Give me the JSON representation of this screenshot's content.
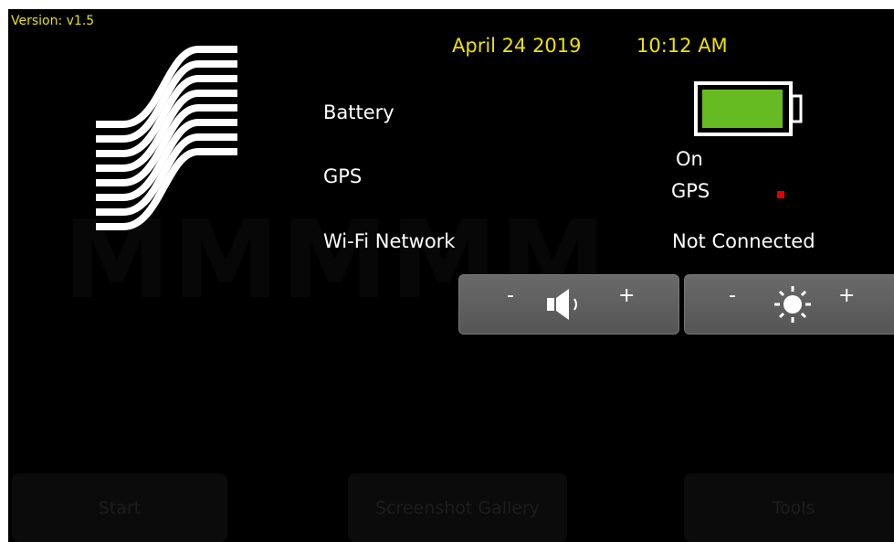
{
  "header": {
    "version": "Version: v1.5",
    "date": "April 24 2019",
    "time": "10:12 AM"
  },
  "status": {
    "battery": {
      "label": "Battery",
      "icon": "battery-full-icon",
      "color": "#66bb22"
    },
    "gps": {
      "label": "GPS",
      "state_line1": "On",
      "state_line2": "GPS",
      "indicator_color": "#e00000"
    },
    "wifi": {
      "label": "Wi-Fi Network",
      "value": "Not Connected"
    }
  },
  "controls": {
    "volume": {
      "minus": "-",
      "plus": "+",
      "icon": "speaker-icon"
    },
    "brightness": {
      "minus": "-",
      "plus": "+",
      "icon": "sun-icon"
    }
  },
  "bottom_buttons": {
    "start": "Start",
    "gallery": "Screenshot Gallery",
    "tools": "Tools"
  },
  "colors": {
    "accent_text": "#ece300",
    "background": "#000000",
    "button": "#5e5e5e"
  }
}
